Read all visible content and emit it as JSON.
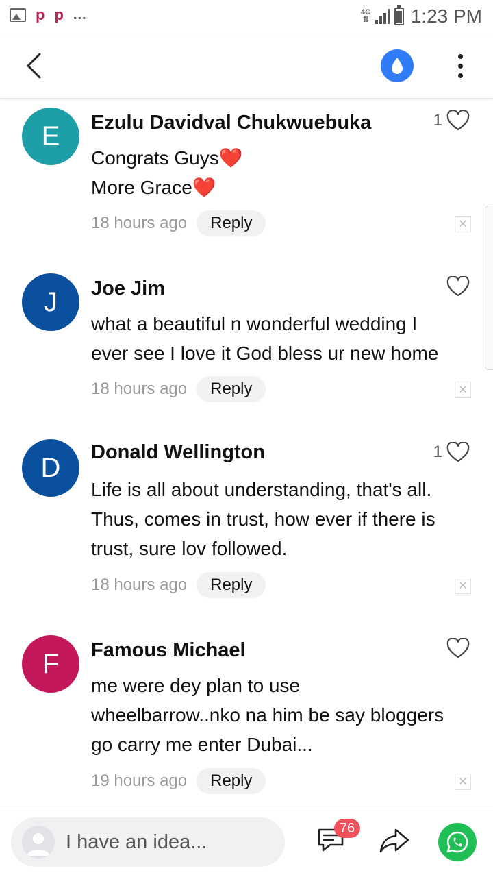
{
  "status_bar": {
    "network": "4G",
    "notif_letters": [
      "p",
      "p"
    ],
    "more": "...",
    "time": "1:23 PM"
  },
  "header": {
    "back_icon": "chevron-left-icon",
    "drop_icon": "water-drop-icon",
    "drop_color": "#2f7cf6",
    "more_icon": "vertical-dots-icon"
  },
  "comments": [
    {
      "initial": "E",
      "avatar_color": "#1e9fa8",
      "name": "Ezulu Davidval Chukwuebuka",
      "likes": "1",
      "lines": [
        "Congrats Guys❤️",
        "More Grace❤️"
      ],
      "time": "18 hours ago",
      "reply": "Reply"
    },
    {
      "initial": "J",
      "avatar_color": "#0b4f9f",
      "name": "Joe Jim",
      "likes": "",
      "lines": [
        "what a beautiful n wonderful wedding I",
        "ever see I love it God bless ur new home"
      ],
      "time": "18 hours ago",
      "reply": "Reply"
    },
    {
      "initial": "D",
      "avatar_color": "#0b4f9f",
      "name": "Donald Wellington",
      "likes": "1",
      "lines": [
        "Life is all about understanding, that's all.",
        "Thus, comes in trust, how ever if there is",
        "trust, sure lov followed."
      ],
      "time": "18 hours ago",
      "reply": "Reply"
    },
    {
      "initial": "F",
      "avatar_color": "#c2185b",
      "name": "Famous Michael",
      "likes": "",
      "lines": [
        "me were dey plan to use",
        "wheelbarrow..nko na him be say bloggers",
        "go carry me enter Dubai..."
      ],
      "time": "19 hours ago",
      "reply": "Reply"
    }
  ],
  "bottom_bar": {
    "placeholder": "I have an idea...",
    "comment_count": "76",
    "share_icon": "share-arrow-icon",
    "whatsapp_icon": "whatsapp-icon",
    "badge_color": "#f2505a",
    "whatsapp_color": "#1fbf55"
  }
}
